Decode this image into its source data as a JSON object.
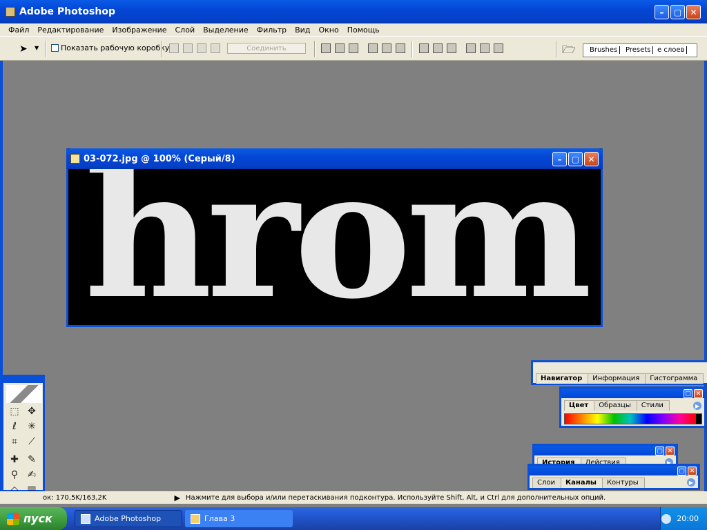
{
  "app": {
    "title": "Adobe Photoshop"
  },
  "menu": [
    "Файл",
    "Редактирование",
    "Изображение",
    "Слой",
    "Выделение",
    "Фильтр",
    "Вид",
    "Окно",
    "Помощь"
  ],
  "options": {
    "show_bounding_box": "Показать рабочую коробку",
    "combine": "Соединить"
  },
  "palette_well": {
    "tabs": [
      "Brushes",
      "Presets",
      "е слоев"
    ]
  },
  "document": {
    "title": "03-072.jpg @ 100% (Серый/8)",
    "canvas_text": "hrom"
  },
  "palettes": {
    "navigator": {
      "tabs": [
        "Навигатор",
        "Информация",
        "Гистограмма"
      ]
    },
    "color": {
      "tabs": [
        "Цвет",
        "Образцы",
        "Стили"
      ]
    },
    "history": {
      "tabs": [
        "История",
        "Действия"
      ]
    },
    "layers": {
      "tabs": [
        "Слои",
        "Каналы",
        "Контуры"
      ]
    }
  },
  "status": {
    "doc_size": "ок: 170,5K/163,2K",
    "hint": "Нажмите для выбора и/или перетаскивания подконтура.  Используйте Shift, Alt, и Ctrl для дополнительных опций."
  },
  "taskbar": {
    "start": "пуск",
    "tasks": [
      "Adobe Photoshop",
      "Глава 3"
    ],
    "clock": "20:00"
  }
}
